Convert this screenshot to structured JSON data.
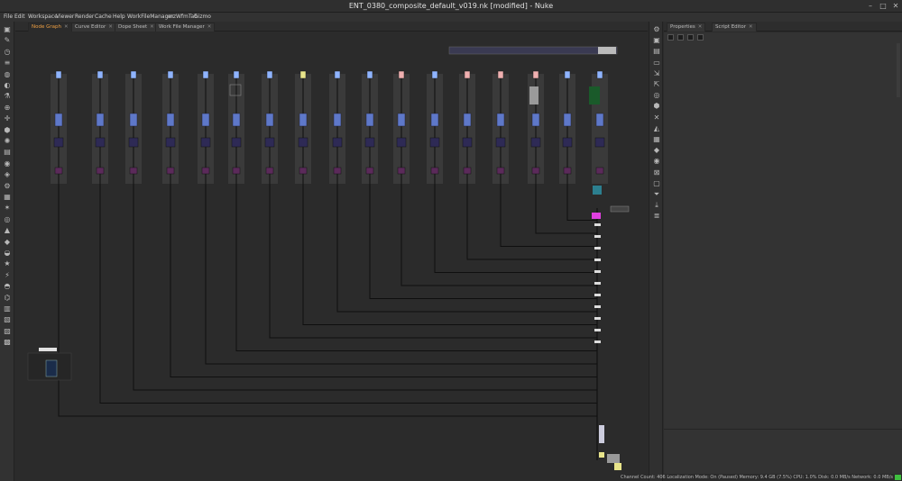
{
  "window": {
    "title": "ENT_0380_composite_default_v019.nk [modified] - Nuke",
    "min_icon": "minimize-icon",
    "max_icon": "maximize-icon",
    "close_icon": "close-icon"
  },
  "menu": [
    "File",
    "Edit",
    "Workspace",
    "Viewer",
    "Render",
    "Cache",
    "Help",
    "WorkFileManager",
    "mzWfmTab",
    "Gizmo"
  ],
  "node_graph_tabs": [
    {
      "label": "Node Graph",
      "active": true
    },
    {
      "label": "Curve Editor",
      "active": false
    },
    {
      "label": "Dope Sheet",
      "active": false
    },
    {
      "label": "Work File Manager",
      "active": false
    }
  ],
  "properties_tabs": [
    {
      "label": "Properties",
      "active": false
    },
    {
      "label": "Script Editor",
      "active": false
    }
  ],
  "left_toolbar_icons": [
    "viewer-icon",
    "paint-icon",
    "time-icon",
    "channel-icon",
    "color-icon",
    "filter-icon",
    "keyer-icon",
    "merge-icon",
    "transform-icon",
    "3d-icon",
    "particles-icon",
    "deep-icon",
    "views-icon",
    "metadata-icon",
    "toolsets-icon",
    "other-icon",
    "furnace-icon",
    "ocula-icon",
    "nukex-icon",
    "gizmo-icon",
    "cara-icon",
    "star-icon",
    "lightning-icon",
    "globe-icon",
    "python-icon",
    "misc-icon",
    "unknown-icon",
    "plugin-icon",
    "custom-icon"
  ],
  "middle_toolbar_icons": [
    "gear-icon",
    "read-icon",
    "write-icon",
    "folder-icon",
    "import-icon",
    "export-icon",
    "render-icon",
    "cube-icon",
    "close-icon",
    "drop-icon",
    "layers-icon",
    "keyframe-icon",
    "camera-icon",
    "delete-icon",
    "frame-icon",
    "funnel-icon",
    "download-icon",
    "align-icon"
  ],
  "status_bar": {
    "text": "Channel Count: 406  Localization Mode: On (Paused)  Memory: 9.4 GB (7.5%)  CPU: 1.0%  Disk: 0.0 MB/s  Network: 0.0 MB/s",
    "indicator_color": "#3fbf3f"
  },
  "colors": {
    "node_read": "#8fb4ff",
    "node_yellow": "#e8e48a",
    "node_pink": "#f0b0b0",
    "node_grade": "#5e78c9",
    "node_dark": "#2e2a55",
    "node_magenta": "#5b2a5a",
    "merge_magenta": "#e040e0",
    "backdrop": "#3a3a3a",
    "wire": "#0f0f0f"
  },
  "graph": {
    "columns": [
      {
        "read_color": "node_read"
      },
      {
        "read_color": "node_read"
      },
      {
        "read_color": "node_read"
      },
      {
        "read_color": "node_read"
      },
      {
        "read_color": "node_read"
      },
      {
        "read_color": "node_read"
      },
      {
        "read_color": "node_read"
      },
      {
        "read_color": "node_yellow"
      },
      {
        "read_color": "node_read"
      },
      {
        "read_color": "node_read"
      },
      {
        "read_color": "node_pink"
      },
      {
        "read_color": "node_read"
      },
      {
        "read_color": "node_pink"
      },
      {
        "read_color": "node_pink"
      },
      {
        "read_color": "node_pink"
      },
      {
        "read_color": "node_read"
      },
      {
        "read_color": "node_read"
      }
    ]
  }
}
